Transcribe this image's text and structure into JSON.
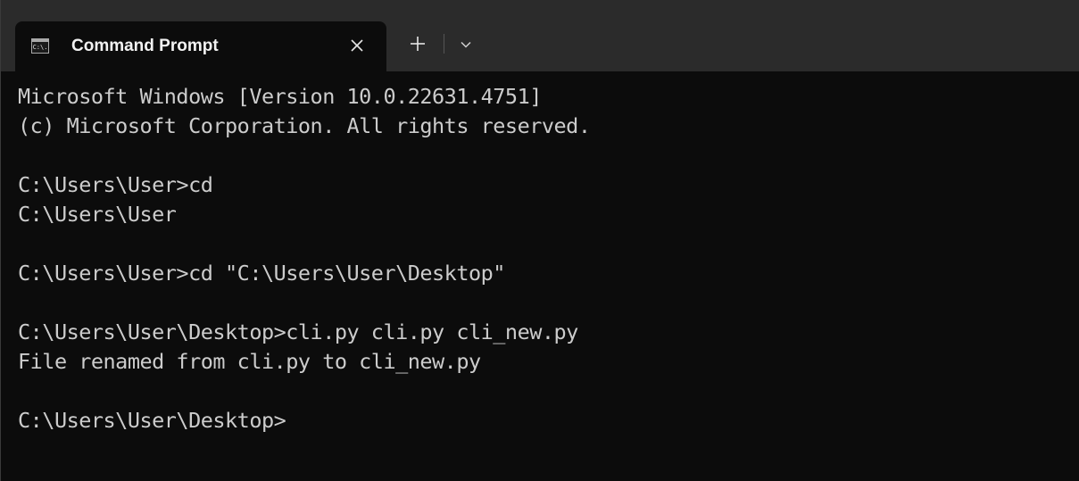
{
  "tab": {
    "icon": "cmd-app-icon",
    "icon_text": "C:\\.",
    "title": "Command Prompt"
  },
  "icons": {
    "close": "close-icon",
    "new_tab": "plus-icon",
    "dropdown": "chevron-down-icon"
  },
  "console": {
    "lines": [
      "Microsoft Windows [Version 10.0.22631.4751]",
      "(c) Microsoft Corporation. All rights reserved.",
      "",
      "C:\\Users\\User>cd",
      "C:\\Users\\User",
      "",
      "C:\\Users\\User>cd \"C:\\Users\\User\\Desktop\"",
      "",
      "C:\\Users\\User\\Desktop>cli.py cli.py cli_new.py",
      "File renamed from cli.py to cli_new.py",
      "",
      "C:\\Users\\User\\Desktop>"
    ]
  },
  "colors": {
    "titlebar": "#2b2b2b",
    "background": "#0c0c0c",
    "text": "#cccccc"
  }
}
